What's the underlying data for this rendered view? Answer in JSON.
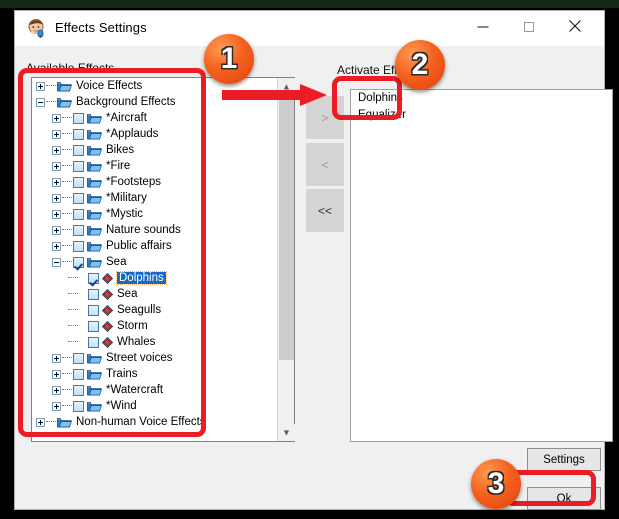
{
  "window": {
    "title": "Effects Settings",
    "icon": "app-face-mic-icon",
    "controls": {
      "minimize": "–",
      "maximize": "□",
      "close": "✕"
    }
  },
  "labels": {
    "available": "Available Effects",
    "active": "Activate Effects"
  },
  "tree": {
    "nodes": [
      {
        "label": "Voice Effects",
        "depth": 0,
        "expander": "plus",
        "checkbox": "none",
        "icon": "folder-icon",
        "selected": false
      },
      {
        "label": "Background Effects",
        "depth": 0,
        "expander": "minus",
        "checkbox": "none",
        "icon": "folder-icon",
        "selected": false
      },
      {
        "label": "*Aircraft",
        "depth": 1,
        "expander": "plus",
        "checkbox": "unchecked",
        "icon": "folder-icon",
        "selected": false
      },
      {
        "label": "*Applauds",
        "depth": 1,
        "expander": "plus",
        "checkbox": "unchecked",
        "icon": "folder-icon",
        "selected": false
      },
      {
        "label": "Bikes",
        "depth": 1,
        "expander": "plus",
        "checkbox": "unchecked",
        "icon": "folder-icon",
        "selected": false
      },
      {
        "label": "*Fire",
        "depth": 1,
        "expander": "plus",
        "checkbox": "unchecked",
        "icon": "folder-icon",
        "selected": false
      },
      {
        "label": "*Footsteps",
        "depth": 1,
        "expander": "plus",
        "checkbox": "unchecked",
        "icon": "folder-icon",
        "selected": false
      },
      {
        "label": "*Military",
        "depth": 1,
        "expander": "plus",
        "checkbox": "unchecked",
        "icon": "folder-icon",
        "selected": false
      },
      {
        "label": "*Mystic",
        "depth": 1,
        "expander": "plus",
        "checkbox": "unchecked",
        "icon": "folder-icon",
        "selected": false
      },
      {
        "label": "Nature sounds",
        "depth": 1,
        "expander": "plus",
        "checkbox": "unchecked",
        "icon": "folder-icon",
        "selected": false
      },
      {
        "label": "Public affairs",
        "depth": 1,
        "expander": "plus",
        "checkbox": "unchecked",
        "icon": "folder-icon",
        "selected": false
      },
      {
        "label": "Sea",
        "depth": 1,
        "expander": "minus",
        "checkbox": "checked",
        "icon": "folder-icon",
        "selected": false
      },
      {
        "label": "Dolphins",
        "depth": 2,
        "expander": "none",
        "checkbox": "checked",
        "icon": "diamond-icon",
        "selected": true
      },
      {
        "label": "Sea",
        "depth": 2,
        "expander": "none",
        "checkbox": "unchecked",
        "icon": "diamond-icon",
        "selected": false
      },
      {
        "label": "Seagulls",
        "depth": 2,
        "expander": "none",
        "checkbox": "unchecked",
        "icon": "diamond-icon",
        "selected": false
      },
      {
        "label": "Storm",
        "depth": 2,
        "expander": "none",
        "checkbox": "unchecked",
        "icon": "diamond-icon",
        "selected": false
      },
      {
        "label": "Whales",
        "depth": 2,
        "expander": "none",
        "checkbox": "unchecked",
        "icon": "diamond-icon",
        "selected": false
      },
      {
        "label": "Street voices",
        "depth": 1,
        "expander": "plus",
        "checkbox": "unchecked",
        "icon": "folder-icon",
        "selected": false
      },
      {
        "label": "Trains",
        "depth": 1,
        "expander": "plus",
        "checkbox": "unchecked",
        "icon": "folder-icon",
        "selected": false
      },
      {
        "label": "*Watercraft",
        "depth": 1,
        "expander": "plus",
        "checkbox": "unchecked",
        "icon": "folder-icon",
        "selected": false
      },
      {
        "label": "*Wind",
        "depth": 1,
        "expander": "plus",
        "checkbox": "unchecked",
        "icon": "folder-icon",
        "selected": false
      },
      {
        "label": "Non-human Voice Effects",
        "depth": 0,
        "expander": "plus",
        "checkbox": "none",
        "icon": "folder-icon",
        "selected": false
      }
    ]
  },
  "transfer_buttons": [
    {
      "label": ">",
      "name": "add-effect-button",
      "enabled": false
    },
    {
      "label": "<",
      "name": "remove-effect-button",
      "enabled": false
    },
    {
      "label": "<<",
      "name": "remove-all-effects-button",
      "enabled": true
    }
  ],
  "active_list": {
    "items": [
      "Dolphins",
      "Equalizer"
    ]
  },
  "buttons": {
    "settings": "Settings",
    "ok": "Ok"
  },
  "annotations": {
    "badges": [
      {
        "number": "1",
        "target": "available-effects-tree"
      },
      {
        "number": "2",
        "target": "active-effects-list"
      },
      {
        "number": "3",
        "target": "ok-button"
      }
    ],
    "arrow": "red-arrow-right",
    "highlight_color": "#ec1c24"
  },
  "colors": {
    "selection": "#1669c5",
    "badge": "#f4621f",
    "annotation": "#ec1c24",
    "dialog_bg": "#f0f0f0",
    "titlebar_bg": "#ffffff"
  }
}
